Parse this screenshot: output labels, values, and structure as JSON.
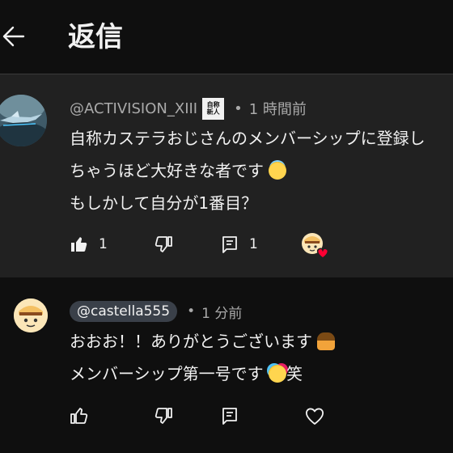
{
  "header": {
    "title": "返信"
  },
  "parent_comment": {
    "handle": "@ACTIVISION_XIII",
    "badge_line1": "自称",
    "badge_line2": "新人",
    "time": "1 時間前",
    "lines": [
      "自称カステラおじさんのメンバーシップに登録し",
      "ちゃうほど大好きな者です",
      "もしかして自分が1番目？"
    ],
    "like_count": "1",
    "reply_count": "1"
  },
  "reply_comment": {
    "handle": "@castella555",
    "time": "1 分前",
    "lines": [
      "おおお！！ありがとうございます",
      "メンバーシップ第一号です",
      "笑"
    ]
  },
  "separator": "•",
  "icons": {
    "back": "arrow-left-icon",
    "like": "thumb-up-icon",
    "dislike": "thumb-down-icon",
    "reply": "comment-icon",
    "heart": "heart-icon"
  },
  "colors": {
    "background": "#0f0f0f",
    "highlight": "#212121",
    "heart": "#ff0033",
    "chip": "#3a4049"
  }
}
